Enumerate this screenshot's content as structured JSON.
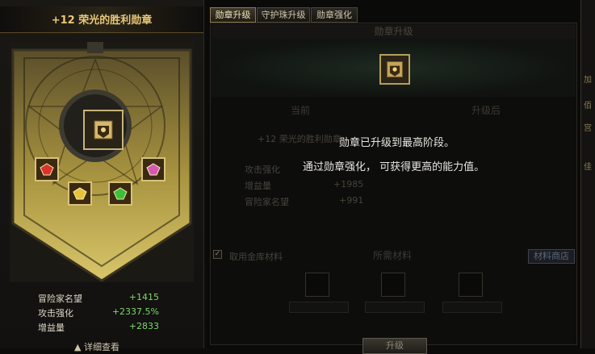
{
  "medal": {
    "title": "+12 荣光的胜利勋章"
  },
  "stats": [
    {
      "label": "冒险家名望",
      "value": "+1415"
    },
    {
      "label": "攻击强化",
      "value": "+2337.5%"
    },
    {
      "label": "增益量",
      "value": "+2833"
    }
  ],
  "detail_link": "▲ 详细查看",
  "tabs": [
    {
      "label": "勋章升级",
      "active": true
    },
    {
      "label": "守护珠升级",
      "active": false
    },
    {
      "label": "勋章强化",
      "active": false
    }
  ],
  "upgrade_panel": {
    "header": "勋章升级",
    "current_label": "当前",
    "after_label": "升级后",
    "current_name": "+12 荣光的胜利勋章",
    "current_stats": [
      {
        "label": "攻击强化",
        "value": ""
      },
      {
        "label": "增益量",
        "value": "+1985"
      },
      {
        "label": "冒险家名望",
        "value": "+991"
      }
    ],
    "message_line1": "勋章已升级到最高阶段。",
    "message_line2": "通过勋章强化， 可获得更高的能力值。",
    "use_storage_label": "取用金库材料",
    "use_storage_checked": true,
    "materials_label": "所需材料",
    "shop_button": "材料商店",
    "upgrade_button": "升级"
  },
  "edge_chars": [
    "加",
    "佰",
    "宫",
    "佳"
  ]
}
